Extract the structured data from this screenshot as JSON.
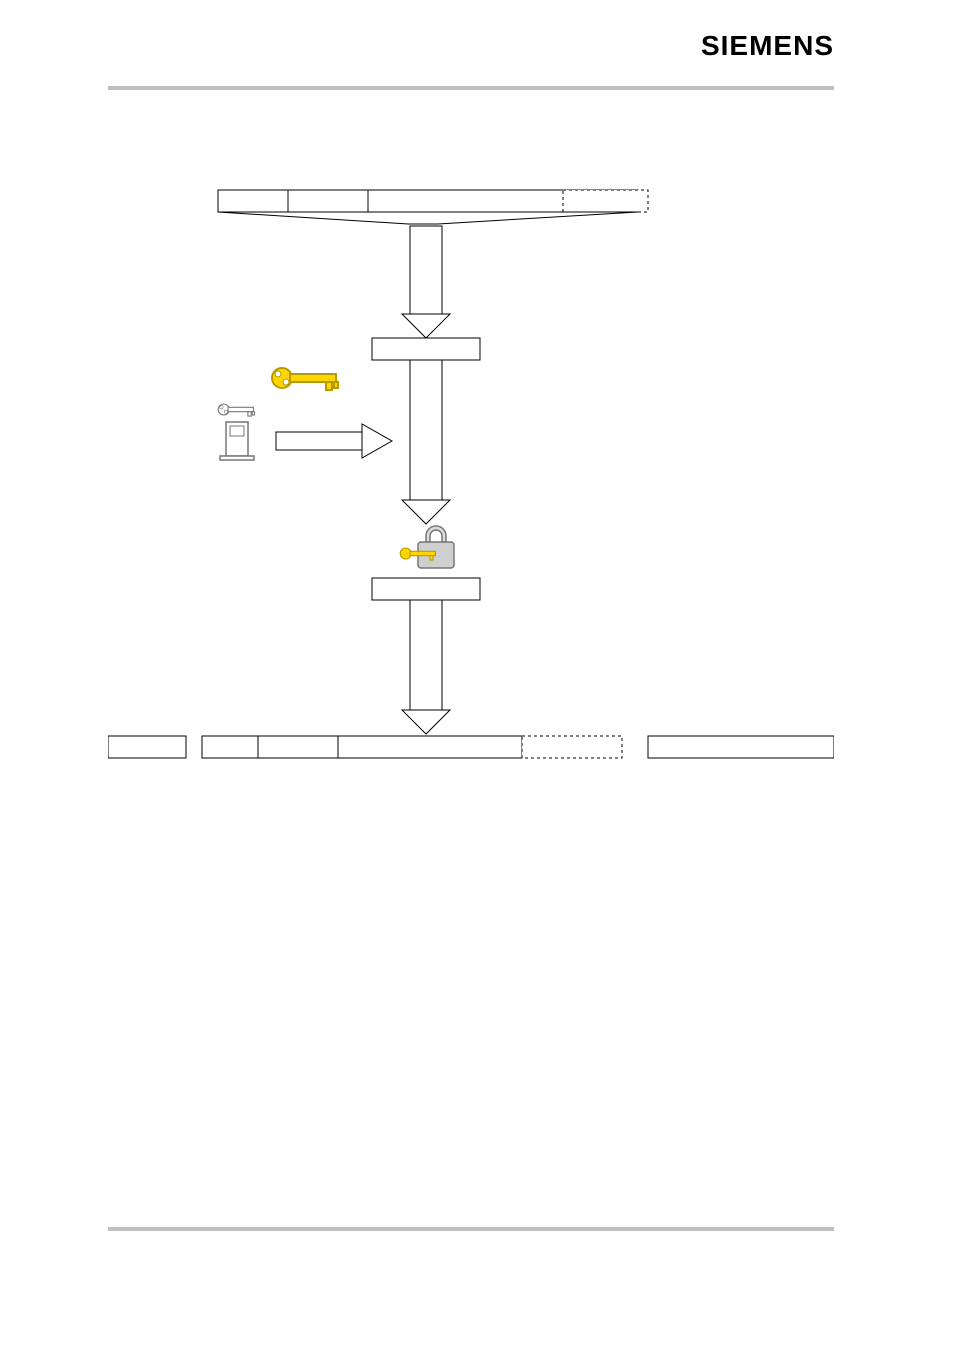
{
  "brand": "SIEMENS",
  "diagram": {
    "top_block": {
      "segments": [
        "",
        "",
        "",
        "",
        ""
      ]
    },
    "middle_box_top": "",
    "left_icons": {
      "large_key": "key-icon",
      "small_key": "key-icon",
      "pedestal_device": "terminal-icon"
    },
    "lock_box": {
      "icon": "lock-with-key-icon",
      "label": ""
    },
    "bottom_row": {
      "left_box": "",
      "middle_block_segments": [
        "",
        "",
        "",
        ""
      ],
      "right_box": ""
    }
  }
}
